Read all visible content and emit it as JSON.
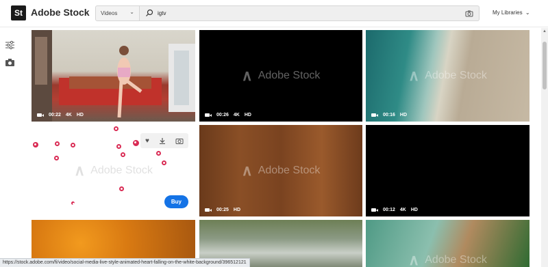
{
  "header": {
    "logo_text": "St",
    "brand": "Adobe Stock",
    "type_select": "Videos",
    "query": "igtv",
    "libraries": "My Libraries"
  },
  "watermark": "Adobe Stock",
  "tiles": [
    {
      "duration": "00:22",
      "res": "4K",
      "q": "HD"
    },
    {
      "duration": "00:26",
      "res": "4K",
      "q": "HD"
    },
    {
      "duration": "00:16",
      "res": "",
      "q": "HD"
    },
    {
      "buy": "Buy"
    },
    {
      "duration": "00:25",
      "res": "",
      "q": "HD"
    },
    {
      "duration": "00:12",
      "res": "4K",
      "q": "HD"
    }
  ],
  "status_url": "https://stock.adobe.com/fi/video/social-media-live-style-animated-heart-falling-on-the-white-background/396512121",
  "colors": {
    "accent": "#1473e6",
    "heart": "#d92b54"
  }
}
